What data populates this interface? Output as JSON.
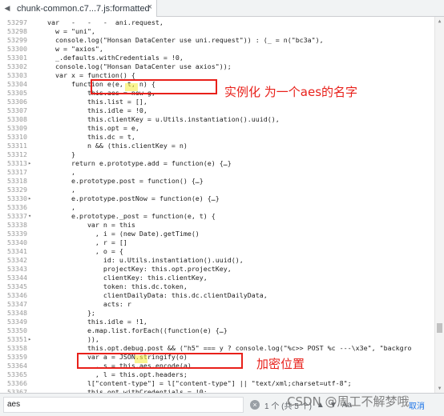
{
  "tab": {
    "title": "chunk-common.c7...7.js:formatted",
    "close": "×"
  },
  "lines": [
    {
      "n": "53297",
      "f": "",
      "t": "  var   -   -   -  ani.request,",
      "c": ""
    },
    {
      "n": "53298",
      "f": "",
      "t": "    w = \"uni\",",
      "c": ""
    },
    {
      "n": "53299",
      "f": "",
      "t": "    console.log(\"Honsan DataCenter use uni.request\")) : (_ = n(\"bc3a\"),",
      "c": ""
    },
    {
      "n": "53300",
      "f": "",
      "t": "    w = \"axios\",",
      "c": ""
    },
    {
      "n": "53301",
      "f": "",
      "t": "    _.defaults.withCredentials = !0,",
      "c": ""
    },
    {
      "n": "53302",
      "f": "",
      "t": "    console.log(\"Honsan DataCenter use axios\"));",
      "c": ""
    },
    {
      "n": "53303",
      "f": "",
      "t": "    var x = function() {",
      "c": ""
    },
    {
      "n": "53304",
      "f": "",
      "t": "        function e(e, t, n) {",
      "c": ""
    },
    {
      "n": "53305",
      "f": "",
      "t": "            this.aes = new g,",
      "c": ""
    },
    {
      "n": "53306",
      "f": "",
      "t": "            this.list = [],",
      "c": ""
    },
    {
      "n": "53307",
      "f": "",
      "t": "            this.idle = !0,",
      "c": ""
    },
    {
      "n": "53308",
      "f": "",
      "t": "            this.clientKey = u.Utils.instantiation().uuid(),",
      "c": ""
    },
    {
      "n": "53309",
      "f": "",
      "t": "            this.opt = e,",
      "c": ""
    },
    {
      "n": "53310",
      "f": "",
      "t": "            this.dc = t,",
      "c": ""
    },
    {
      "n": "53311",
      "f": "",
      "t": "            n && (this.clientKey = n)",
      "c": ""
    },
    {
      "n": "53312",
      "f": "",
      "t": "        }",
      "c": ""
    },
    {
      "n": "53313",
      "f": "▸",
      "t": "        return e.prototype.add = function(e) {…}",
      "c": ""
    },
    {
      "n": "53317",
      "f": "",
      "t": "        ,",
      "c": ""
    },
    {
      "n": "53318",
      "f": "",
      "t": "        e.prototype.post = function() {…}",
      "c": ""
    },
    {
      "n": "53329",
      "f": "",
      "t": "        ,",
      "c": ""
    },
    {
      "n": "53330",
      "f": "▸",
      "t": "        e.prototype.postNow = function(e) {…}",
      "c": ""
    },
    {
      "n": "53336",
      "f": "",
      "t": "        ,",
      "c": ""
    },
    {
      "n": "53337",
      "f": "▾",
      "t": "        e.prototype._post = function(e, t) {",
      "c": ""
    },
    {
      "n": "53338",
      "f": "",
      "t": "            var n = this",
      "c": ""
    },
    {
      "n": "53339",
      "f": "",
      "t": "              , i = (new Date).getTime()",
      "c": ""
    },
    {
      "n": "53340",
      "f": "",
      "t": "              , r = []",
      "c": ""
    },
    {
      "n": "53341",
      "f": "",
      "t": "              , o = {",
      "c": ""
    },
    {
      "n": "53342",
      "f": "",
      "t": "                id: u.Utils.instantiation().uuid(),",
      "c": ""
    },
    {
      "n": "53343",
      "f": "",
      "t": "                projectKey: this.opt.projectKey,",
      "c": ""
    },
    {
      "n": "53344",
      "f": "",
      "t": "                clientKey: this.clientKey,",
      "c": ""
    },
    {
      "n": "53345",
      "f": "",
      "t": "                token: this.dc.token,",
      "c": ""
    },
    {
      "n": "53346",
      "f": "",
      "t": "                clientDailyData: this.dc.clientDailyData,",
      "c": ""
    },
    {
      "n": "53347",
      "f": "",
      "t": "                acts: r",
      "c": ""
    },
    {
      "n": "53348",
      "f": "",
      "t": "            };",
      "c": ""
    },
    {
      "n": "53349",
      "f": "",
      "t": "            this.idle = !1,",
      "c": ""
    },
    {
      "n": "53350",
      "f": "",
      "t": "            e.map.list.forEach((function(e) {…}",
      "c": ""
    },
    {
      "n": "53351",
      "f": "▸",
      "t": "            )),",
      "c": ""
    },
    {
      "n": "53358",
      "f": "",
      "t": "            this.opt.debug.post && (\"h5\" === y ? console.log(\"%c>> POST %c ---\\x3e\", \"backgro",
      "c": ""
    },
    {
      "n": "53359",
      "f": "",
      "t": "            var a = JSON.stringify(o)",
      "c": ""
    },
    {
      "n": "53364",
      "f": "",
      "t": "              , s = this.aes.encode(a)",
      "c": ""
    },
    {
      "n": "53365",
      "f": "",
      "t": "              , l = this.opt.headers;",
      "c": ""
    },
    {
      "n": "53366",
      "f": "",
      "t": "            l[\"content-type\"] = l[\"content-type\"] || \"text/xml;charset=utf-8\";",
      "c": ""
    },
    {
      "n": "53367",
      "f": "",
      "t": "            this.opt.withCredentials = !0;",
      "c": ""
    }
  ],
  "annotations": {
    "instantiate": "实例化 为一个aes的名字",
    "encrypt": "加密位置"
  },
  "search": {
    "value": "aes",
    "count": "1 个 (共 5 个)",
    "case_label": "Aa",
    "cancel": "取消"
  },
  "watermark": "CSDN @周工不解梦哦"
}
